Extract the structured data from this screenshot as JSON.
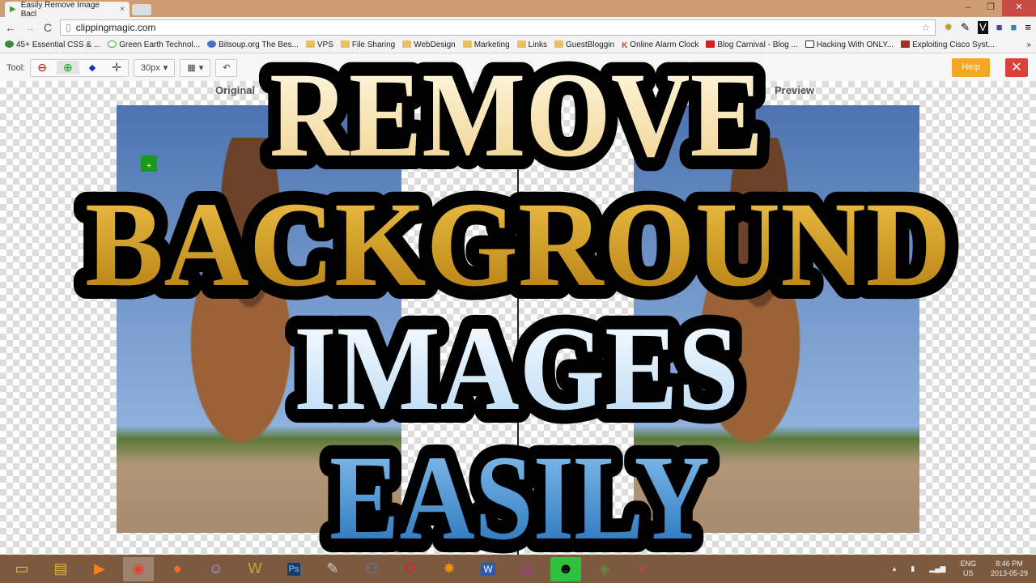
{
  "browser": {
    "tab_title": "Easily Remove Image Bacl",
    "url": "clippingmagic.com",
    "bookmarks": [
      "45+ Essential CSS & ...",
      "Green Earth Technol...",
      "Bitsoup.org The Bes...",
      "VPS",
      "File Sharing",
      "WebDesign",
      "Marketing",
      "Links",
      "GuestBloggin",
      "Online Alarm Clock",
      "Blog Carnival - Blog ...",
      "Hacking With ONLY...",
      "Exploiting Cisco Syst...",
      "»"
    ]
  },
  "toolbar": {
    "tool_label": "Tool:",
    "brush_size": "30px",
    "help_label": "Help",
    "close_label": "✕"
  },
  "panels": {
    "original_label": "Original",
    "preview_label": "Preview"
  },
  "overlay": {
    "line1": "REMOVE",
    "line2": "BACKGROUND",
    "line3": "IMAGES",
    "line4": "EASILY"
  },
  "colors": {
    "help": "#f5a623",
    "close": "#d9413a",
    "taskbar": "#7b5a3f",
    "titlebar": "#cf9d72"
  },
  "taskbar": {
    "apps": [
      "file-explorer",
      "libraries",
      "media-player",
      "chrome",
      "firefox",
      "pidgin",
      "world-of-warcraft",
      "photoshop",
      "pencil",
      "network",
      "opera",
      "avast",
      "word",
      "winrar",
      "ghostery",
      "game",
      "paint"
    ],
    "lang": "ENG",
    "region": "US",
    "time": "8:46 PM",
    "date": "2013-05-29"
  }
}
